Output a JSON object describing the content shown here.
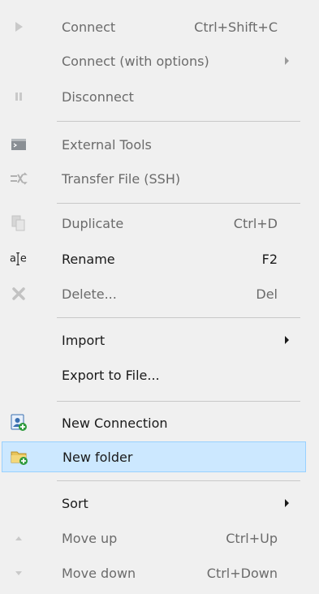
{
  "menu": {
    "items": [
      {
        "label": "Connect",
        "shortcut": "Ctrl+Shift+C",
        "icon": "play-icon",
        "enabled": false
      },
      {
        "label": "Connect (with options)",
        "shortcut": "",
        "icon": "",
        "enabled": false,
        "submenu": true
      },
      {
        "label": "Disconnect",
        "shortcut": "",
        "icon": "pause-icon",
        "enabled": false
      },
      {
        "label": "External Tools",
        "shortcut": "",
        "icon": "terminal-icon",
        "enabled": false
      },
      {
        "label": "Transfer File (SSH)",
        "shortcut": "",
        "icon": "transfer-icon",
        "enabled": false
      },
      {
        "label": "Duplicate",
        "shortcut": "Ctrl+D",
        "icon": "duplicate-icon",
        "enabled": false
      },
      {
        "label": "Rename",
        "shortcut": "F2",
        "icon": "rename-icon",
        "enabled": true
      },
      {
        "label": "Delete...",
        "shortcut": "Del",
        "icon": "delete-icon",
        "enabled": false
      },
      {
        "label": "Import",
        "shortcut": "",
        "icon": "",
        "enabled": true,
        "submenu": true
      },
      {
        "label": "Export to File...",
        "shortcut": "",
        "icon": "",
        "enabled": true
      },
      {
        "label": "New Connection",
        "shortcut": "",
        "icon": "new-connection-icon",
        "enabled": true
      },
      {
        "label": "New folder",
        "shortcut": "",
        "icon": "new-folder-icon",
        "enabled": true,
        "highlighted": true
      },
      {
        "label": "Sort",
        "shortcut": "",
        "icon": "",
        "enabled": true,
        "submenu": true
      },
      {
        "label": "Move up",
        "shortcut": "Ctrl+Up",
        "icon": "up-icon",
        "enabled": false
      },
      {
        "label": "Move down",
        "shortcut": "Ctrl+Down",
        "icon": "down-icon",
        "enabled": false
      }
    ]
  },
  "colors": {
    "highlight": "#cce8ff",
    "highlight_border": "#99d1ff",
    "disabled_text": "#6b6b6b"
  }
}
